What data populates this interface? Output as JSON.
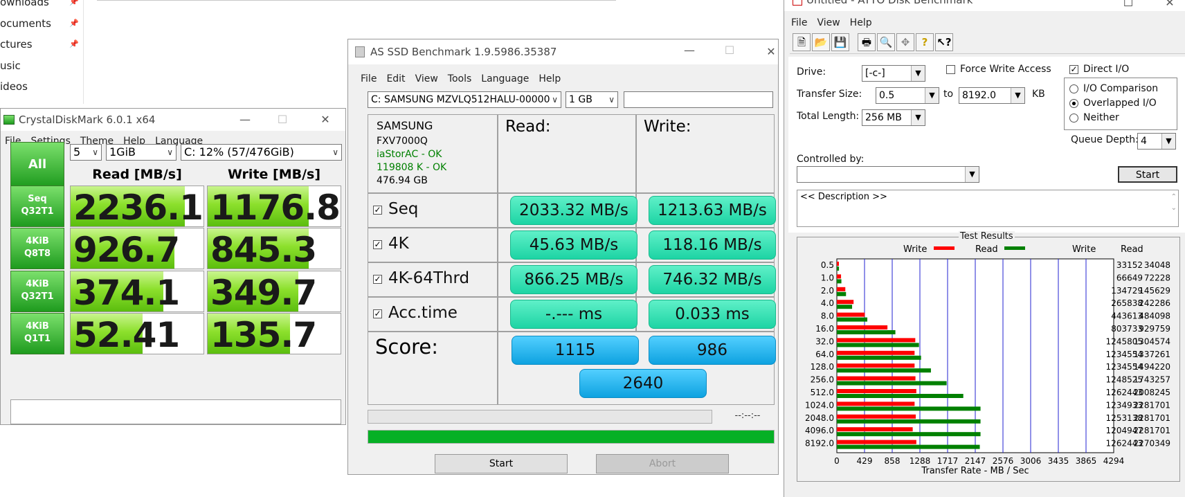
{
  "explorer": {
    "items": [
      {
        "label": "ownloads",
        "pinned": true
      },
      {
        "label": "ocuments",
        "pinned": true
      },
      {
        "label": "ctures",
        "pinned": true
      },
      {
        "label": "usic",
        "pinned": false
      },
      {
        "label": "ideos",
        "pinned": false
      }
    ]
  },
  "cdm": {
    "title": "CrystalDiskMark 6.0.1 x64",
    "menu": [
      "File",
      "Settings",
      "Theme",
      "Help",
      "Language"
    ],
    "all_label": "All",
    "count": "5",
    "size": "1GiB",
    "drive": "C: 12% (57/476GiB)",
    "read_header": "Read [MB/s]",
    "write_header": "Write [MB/s]",
    "rows": [
      {
        "label1": "Seq",
        "label2": "Q32T1",
        "read": "2236.1",
        "write": "1176.8",
        "read_fill": 0.86,
        "write_fill": 0.76
      },
      {
        "label1": "4KiB",
        "label2": "Q8T8",
        "read": "926.7",
        "write": "845.3",
        "read_fill": 0.78,
        "write_fill": 0.76
      },
      {
        "label1": "4KiB",
        "label2": "Q32T1",
        "read": "374.1",
        "write": "349.7",
        "read_fill": 0.7,
        "write_fill": 0.68
      },
      {
        "label1": "4KiB",
        "label2": "Q1T1",
        "read": "52.41",
        "write": "135.7",
        "read_fill": 0.54,
        "write_fill": 0.62
      }
    ],
    "comment": ""
  },
  "asssd": {
    "title": "AS SSD Benchmark 1.9.5986.35387",
    "menu": [
      "File",
      "Edit",
      "View",
      "Tools",
      "Language",
      "Help"
    ],
    "drive": "C: SAMSUNG MZVLQ512HALU-00000",
    "size": "1 GB",
    "info": {
      "vendor": "SAMSUNG",
      "firmware": "FXV7000Q",
      "driver": "iaStorAC - OK",
      "alignment": "119808 K - OK",
      "capacity": "476.94 GB"
    },
    "read_header": "Read:",
    "write_header": "Write:",
    "rows": [
      {
        "label": "Seq",
        "read": "2033.32 MB/s",
        "write": "1213.63 MB/s"
      },
      {
        "label": "4K",
        "read": "45.63 MB/s",
        "write": "118.16 MB/s"
      },
      {
        "label": "4K-64Thrd",
        "read": "866.25 MB/s",
        "write": "746.32 MB/s"
      },
      {
        "label": "Acc.time",
        "read": "-.--- ms",
        "write": "0.033 ms"
      }
    ],
    "score_label": "Score:",
    "score_read": "1115",
    "score_write": "986",
    "score_total": "2640",
    "time": "--:--:--",
    "progress": 1.0,
    "start": "Start",
    "abort": "Abort",
    "colors": {
      "green": "#1dd4a4",
      "blue": "#0ea2e0",
      "progress": "#06b025"
    }
  },
  "atto": {
    "title": "Untitled - ATTO Disk Benchmark",
    "menu": [
      "File",
      "View",
      "Help"
    ],
    "drive_label": "Drive:",
    "drive": "[-c-]",
    "force_write": "Force Write Access",
    "direct_io": "Direct I/O",
    "transfer_label": "Transfer Size:",
    "transfer_from": "0.5",
    "to_label": "to",
    "transfer_to": "8192.0",
    "kb": "KB",
    "total_label": "Total Length:",
    "total": "256 MB",
    "io_comparison": "I/O Comparison",
    "overlapped_io": "Overlapped I/O",
    "neither": "Neither",
    "queue_label": "Queue Depth:",
    "queue": "4",
    "controlled_label": "Controlled by:",
    "start": "Start",
    "description": "<< Description >>",
    "results_title": "Test Results",
    "legend_write": "Write",
    "legend_read": "Read",
    "col_write": "Write",
    "col_read": "Read",
    "xlabel": "Transfer Rate - MB / Sec",
    "xticks": [
      "0",
      "429",
      "858",
      "1288",
      "1717",
      "2147",
      "2576",
      "3006",
      "3435",
      "3865",
      "4294"
    ]
  },
  "chart_data": {
    "type": "bar",
    "title": "Test Results",
    "xlabel": "Transfer Rate - MB / Sec",
    "xlim": [
      0,
      4294
    ],
    "categories": [
      "0.5",
      "1.0",
      "2.0",
      "4.0",
      "8.0",
      "16.0",
      "32.0",
      "64.0",
      "128.0",
      "256.0",
      "512.0",
      "1024.0",
      "2048.0",
      "4096.0",
      "8192.0"
    ],
    "series": [
      {
        "name": "Write",
        "color": "#ff0000",
        "values": [
          33152,
          66649,
          134729,
          265838,
          443613,
          803733,
          1245805,
          1234554,
          1234554,
          1248525,
          1262443,
          1234933,
          1253138,
          1204947,
          1262443
        ]
      },
      {
        "name": "Read",
        "color": "#008000",
        "values": [
          34048,
          72228,
          145629,
          242286,
          484098,
          929759,
          1304574,
          1337261,
          1494220,
          1743257,
          2008245,
          2281701,
          2281701,
          2281701,
          2270349
        ]
      }
    ]
  }
}
